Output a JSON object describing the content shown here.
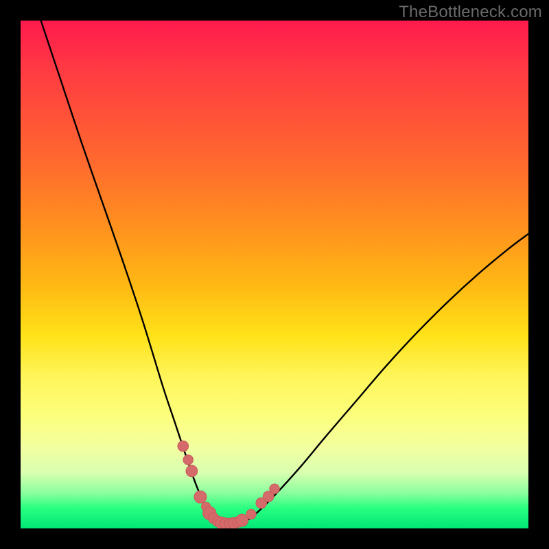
{
  "watermark": "TheBottleneck.com",
  "colors": {
    "frame": "#000000",
    "curve": "#000000",
    "markers": "#d46a6a",
    "markerStroke": "#c95b5b"
  },
  "chart_data": {
    "type": "line",
    "title": "",
    "xlabel": "",
    "ylabel": "",
    "xlim": [
      0,
      100
    ],
    "ylim": [
      0,
      100
    ],
    "grid": false,
    "series": [
      {
        "name": "bottleneck-curve",
        "x": [
          4,
          8,
          12,
          16,
          20,
          24,
          28,
          30,
          32,
          33.5,
          35,
          36.5,
          38,
          39,
          40,
          42,
          44,
          46,
          50,
          55,
          60,
          66,
          72,
          78,
          84,
          90,
          96,
          100
        ],
        "y": [
          100,
          88,
          76,
          64.5,
          53,
          41,
          28,
          22,
          16,
          11.5,
          7.5,
          4.5,
          2.4,
          1.4,
          1.0,
          1.0,
          1.4,
          2.6,
          6.5,
          12,
          18,
          25,
          32,
          38.5,
          44.5,
          50,
          55,
          58
        ]
      }
    ],
    "markers": [
      {
        "x": 32.0,
        "y": 16.2,
        "r": 1.3
      },
      {
        "x": 33.0,
        "y": 13.5,
        "r": 1.2
      },
      {
        "x": 33.7,
        "y": 11.3,
        "r": 1.4
      },
      {
        "x": 35.4,
        "y": 6.2,
        "r": 1.5
      },
      {
        "x": 36.5,
        "y": 4.3,
        "r": 1.1
      },
      {
        "x": 37.2,
        "y": 3.0,
        "r": 1.6
      },
      {
        "x": 38.0,
        "y": 2.0,
        "r": 1.3
      },
      {
        "x": 38.8,
        "y": 1.4,
        "r": 1.3
      },
      {
        "x": 39.6,
        "y": 1.05,
        "r": 1.5
      },
      {
        "x": 40.4,
        "y": 0.95,
        "r": 1.4
      },
      {
        "x": 41.2,
        "y": 0.95,
        "r": 1.3
      },
      {
        "x": 42.0,
        "y": 1.05,
        "r": 1.4
      },
      {
        "x": 42.8,
        "y": 1.25,
        "r": 1.3
      },
      {
        "x": 43.6,
        "y": 1.6,
        "r": 1.5
      },
      {
        "x": 45.4,
        "y": 2.8,
        "r": 1.2
      },
      {
        "x": 47.4,
        "y": 5.0,
        "r": 1.3
      },
      {
        "x": 48.8,
        "y": 6.3,
        "r": 1.3
      },
      {
        "x": 50.0,
        "y": 7.8,
        "r": 1.2
      }
    ]
  }
}
